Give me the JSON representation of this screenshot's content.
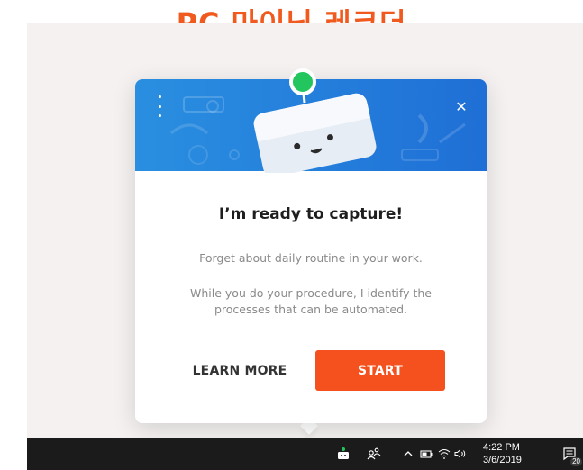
{
  "headline": "PC 마이닝 레코더",
  "popup": {
    "title": "I’m ready to capture!",
    "description": "Forget about daily routine in your work.",
    "detail": "While you do your procedure, I identify the processes that can be automated.",
    "learn_more_label": "LEARN MORE",
    "start_label": "START",
    "close_glyph": "✕"
  },
  "taskbar": {
    "time": "4:22 PM",
    "date": "3/6/2019",
    "notification_count": "20"
  },
  "icons": {
    "menu": "vertical-dots-icon",
    "close": "close-icon",
    "robot": "robot-mascot-icon",
    "tray": [
      "robot-tray-icon",
      "people-icon",
      "chevron-up-icon",
      "battery-icon",
      "wifi-icon",
      "volume-icon",
      "notification-icon"
    ]
  },
  "colors": {
    "headline": "#f05a1e",
    "header_blue": "#1f78dc",
    "start_button": "#f4511e",
    "robot_antenna": "#22c55e",
    "taskbar": "#1b1b1b"
  }
}
